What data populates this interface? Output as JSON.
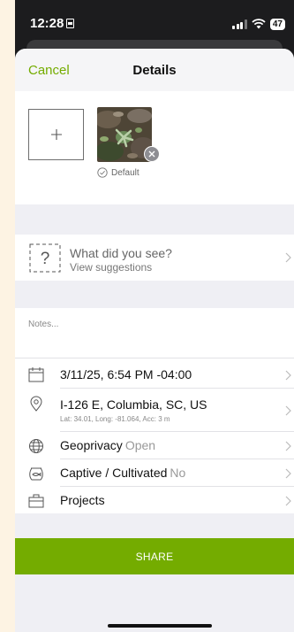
{
  "status_bar": {
    "time": "12:28",
    "battery": "47"
  },
  "nav": {
    "cancel_label": "Cancel",
    "title": "Details"
  },
  "photos": {
    "default_label": "Default"
  },
  "taxon": {
    "prompt": "What did you see?",
    "suggestions_label": "View suggestions"
  },
  "notes": {
    "placeholder": "Notes..."
  },
  "details": {
    "date": "3/11/25, 6:54 PM -04:00",
    "location": "I-126 E, Columbia, SC, US",
    "coords": "Lat: 34.01, Long: -81.064, Acc: 3 m",
    "geoprivacy_label": "Geoprivacy",
    "geoprivacy_value": "Open",
    "captive_label": "Captive / Cultivated",
    "captive_value": "No",
    "projects_label": "Projects"
  },
  "share_label": "SHARE",
  "colors": {
    "accent": "#74ac00",
    "sheet_bg": "#efeff4"
  },
  "icons": {
    "add_photo": "plus-icon",
    "remove_photo": "close-icon",
    "default": "check-circle-icon",
    "taxon": "question-box-icon",
    "date": "calendar-icon",
    "location": "location-pin-icon",
    "geoprivacy": "globe-icon",
    "captive": "fishbowl-icon",
    "projects": "briefcase-icon"
  }
}
